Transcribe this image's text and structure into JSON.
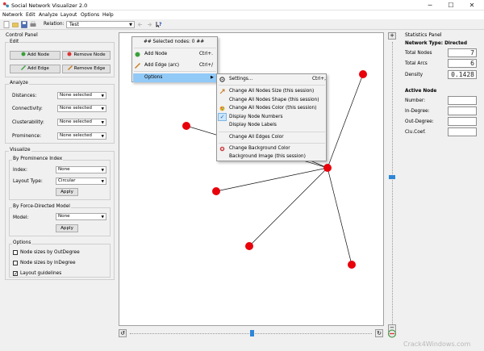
{
  "window": {
    "title": "Social Network Visualizer 2.0",
    "minimize": "─",
    "maximize": "☐",
    "close": "✕"
  },
  "menubar": [
    "Network",
    "Edit",
    "Analyze",
    "Layout",
    "Options",
    "Help"
  ],
  "toolbar": {
    "relation_label": "Relation:",
    "relation_value": "Test"
  },
  "control_panel": {
    "title": "Control Panel",
    "edit": {
      "title": "Edit",
      "add_node": "Add Node",
      "remove_node": "Remove Node",
      "add_edge": "Add Edge",
      "remove_edge": "Remove Edge"
    },
    "analyze": {
      "title": "Analyze",
      "rows": [
        {
          "label": "Distances:",
          "value": "None selected"
        },
        {
          "label": "Connectivity:",
          "value": "None selected"
        },
        {
          "label": "Clusterability:",
          "value": "None selected"
        },
        {
          "label": "Prominence:",
          "value": "None selected"
        }
      ]
    },
    "visualize": {
      "title": "Visualize",
      "by_prominence": {
        "title": "By Prominence Index",
        "index_label": "Index:",
        "index_value": "None",
        "layout_label": "Layout Type:",
        "layout_value": "Circular",
        "apply": "Apply"
      },
      "by_force": {
        "title": "By Force-Directed Model",
        "model_label": "Model:",
        "model_value": "None",
        "apply": "Apply"
      }
    },
    "options": {
      "title": "Options",
      "items": [
        {
          "label": "Node sizes by OutDegree",
          "checked": false
        },
        {
          "label": "Node sizes by InDegree",
          "checked": false
        },
        {
          "label": "Layout guidelines",
          "checked": true
        }
      ]
    }
  },
  "context_menu": {
    "header": "## Selected nodes: 0 ##",
    "add_node": "Add Node",
    "add_node_shortcut": "Ctrl+.",
    "add_edge": "Add Edge (arc)",
    "add_edge_shortcut": "Ctrl+/",
    "options": "Options"
  },
  "submenu": {
    "settings": "Settings...",
    "settings_shortcut": "Ctrl+,",
    "items": [
      "Change All Nodes Size (this session)",
      "Change All Nodes Shape (this session)",
      "Change All Nodes Color (this session)",
      "Display Node Numbers",
      "Display Node Labels",
      "Change All Edges Color",
      "Change Background Color",
      "Background Image (this session)"
    ]
  },
  "statistics_panel": {
    "title": "Statistics Panel",
    "network_type": "Network Type: Directed",
    "total_nodes_label": "Total Nodes",
    "total_nodes": "7",
    "total_arcs_label": "Total Arcs",
    "total_arcs": "6",
    "density_label": "Density",
    "density": "0.1428",
    "active_node_title": "Active Node",
    "number_label": "Number:",
    "indegree_label": "In-Degree:",
    "outdegree_label": "Out-Degree:",
    "clucoef_label": "Clu.Coef."
  },
  "watermark": "Crack4Windows.com",
  "colors": {
    "node": "#e8000b",
    "menu_highlight": "#91c9f7",
    "slider": "#2f86d6"
  }
}
